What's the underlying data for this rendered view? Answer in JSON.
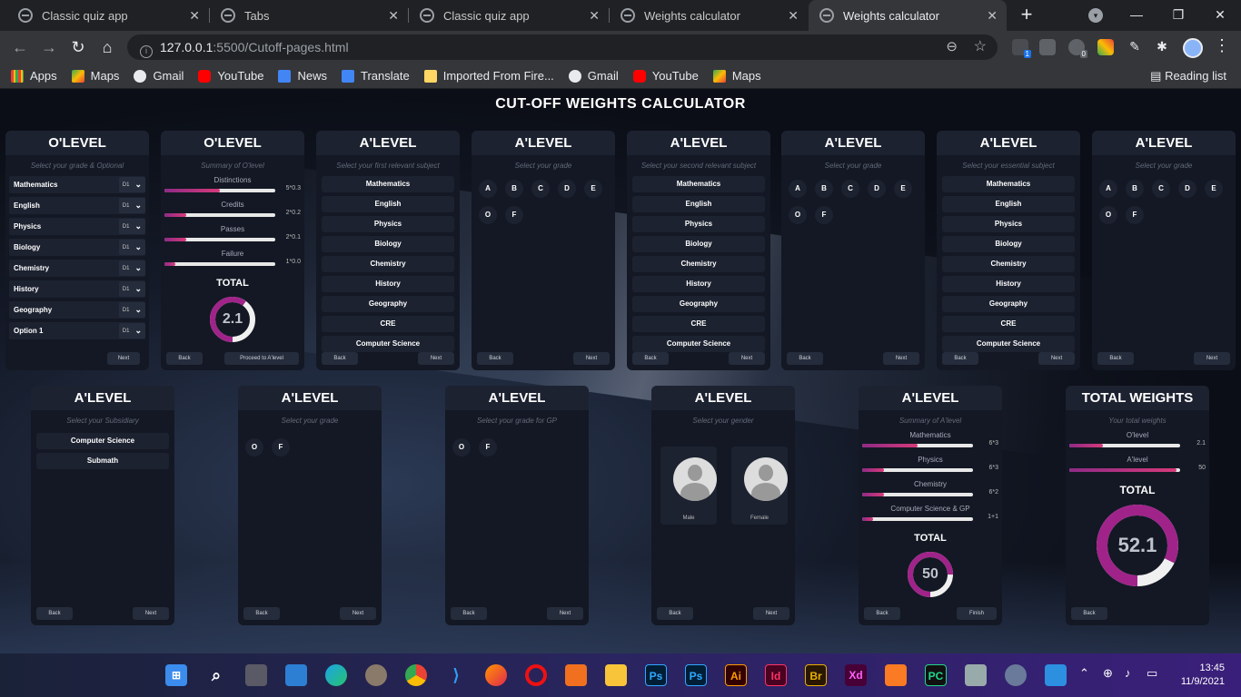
{
  "browser": {
    "tabs": [
      {
        "title": "Classic quiz app",
        "active": false
      },
      {
        "title": "Tabs",
        "active": false
      },
      {
        "title": "Classic quiz app",
        "active": false
      },
      {
        "title": "Weights calculator",
        "active": false
      },
      {
        "title": "Weights calculator",
        "active": true
      }
    ],
    "url_host": "127.0.0.1",
    "url_path": ":5500/Cutoff-pages.html",
    "bookmarks": [
      "Apps",
      "Maps",
      "Gmail",
      "YouTube",
      "News",
      "Translate",
      "Imported From Fire...",
      "Gmail",
      "YouTube",
      "Maps"
    ],
    "reading_list": "Reading list",
    "ext_badges": [
      "1",
      "0"
    ]
  },
  "page": {
    "title": "CUT-OFF WEIGHTS CALCULATOR",
    "c1": {
      "header": "O'LEVEL",
      "sub": "Select your grade & Optional",
      "rows": [
        {
          "s": "Mathematics",
          "g": "D1"
        },
        {
          "s": "English",
          "g": "D1"
        },
        {
          "s": "Physics",
          "g": "D1"
        },
        {
          "s": "Biology",
          "g": "D1"
        },
        {
          "s": "Chemistry",
          "g": "D1"
        },
        {
          "s": "History",
          "g": "D1"
        },
        {
          "s": "Geography",
          "g": "D1"
        },
        {
          "s": "Option 1",
          "g": "D1"
        }
      ],
      "next": "Next"
    },
    "c2": {
      "header": "O'LEVEL",
      "sub": "Summary of O'level",
      "items": [
        {
          "label": "Distinctions",
          "value": "5*0.3",
          "pct": 0.5
        },
        {
          "label": "Credits",
          "value": "2*0.2",
          "pct": 0.2
        },
        {
          "label": "Passes",
          "value": "2*0.1",
          "pct": 0.2
        },
        {
          "label": "Failure",
          "value": "1*0.0",
          "pct": 0.1
        }
      ],
      "total_label": "TOTAL",
      "total": "2.1",
      "ring_pct": 0.6,
      "back": "Back",
      "proceed": "Proceed to A'level"
    },
    "c3": {
      "header": "A'LEVEL",
      "sub": "Select your first relevant subject",
      "back": "Back",
      "next": "Next"
    },
    "c4": {
      "header": "A'LEVEL",
      "sub": "Select your grade",
      "back": "Back",
      "next": "Next"
    },
    "c5": {
      "header": "A'LEVEL",
      "sub": "Select your second relevant subject",
      "back": "Back",
      "next": "Next"
    },
    "c6": {
      "header": "A'LEVEL",
      "sub": "Select your grade",
      "back": "Back",
      "next": "Next"
    },
    "c7": {
      "header": "A'LEVEL",
      "sub": "Select your essential subject",
      "back": "Back",
      "next": "Next"
    },
    "c8": {
      "header": "A'LEVEL",
      "sub": "Select your grade",
      "back": "Back",
      "next": "Next"
    },
    "subjects": [
      "Mathematics",
      "English",
      "Physics",
      "Biology",
      "Chemistry",
      "History",
      "Geography",
      "CRE",
      "Computer Science"
    ],
    "grades": [
      "A",
      "B",
      "C",
      "D",
      "E",
      "O",
      "F"
    ],
    "c9": {
      "header": "A'LEVEL",
      "sub": "Select your Subsidiary",
      "options": [
        "Computer Science",
        "Submath"
      ],
      "back": "Back",
      "next": "Next"
    },
    "c10": {
      "header": "A'LEVEL",
      "sub": "Select your grade",
      "grades": [
        "O",
        "F"
      ],
      "back": "Back",
      "next": "Next"
    },
    "c11": {
      "header": "A'LEVEL",
      "sub": "Select your grade for GP",
      "grades": [
        "O",
        "F"
      ],
      "back": "Back",
      "next": "Next"
    },
    "c12": {
      "header": "A'LEVEL",
      "sub": "Select your gender",
      "male": "Male",
      "female": "Female",
      "back": "Back",
      "next": "Next"
    },
    "c13": {
      "header": "A'LEVEL",
      "sub": "Summary of A'level",
      "items": [
        {
          "label": "Mathematics",
          "value": "6*3",
          "pct": 0.5
        },
        {
          "label": "Physics",
          "value": "6*3",
          "pct": 0.2
        },
        {
          "label": "Chemistry",
          "value": "6*2",
          "pct": 0.2
        },
        {
          "label": "Computer Science & GP",
          "value": "1+1",
          "pct": 0.1
        }
      ],
      "total_label": "TOTAL",
      "total": "50",
      "ring_pct": 0.75,
      "back": "Back",
      "finish": "Finish"
    },
    "c14": {
      "header": "TOTAL WEIGHTS",
      "sub": "Your total weights",
      "items": [
        {
          "label": "O'level",
          "value": "2.1",
          "pct": 0.3
        },
        {
          "label": "A'level",
          "value": "50",
          "pct": 0.97
        }
      ],
      "total_label": "TOTAL",
      "total": "52.1",
      "ring_pct": 0.82,
      "back": "Back"
    }
  },
  "taskbar": {
    "time": "13:45",
    "date": "11/9/2021",
    "apps": [
      "Ps",
      "Ps",
      "Ai",
      "Id",
      "Br",
      "Xd",
      "PC"
    ]
  },
  "colors": {
    "accent": "#d63a7a",
    "accent2": "#8e2a86",
    "card": "#131824",
    "card_header": "#1c2230"
  }
}
